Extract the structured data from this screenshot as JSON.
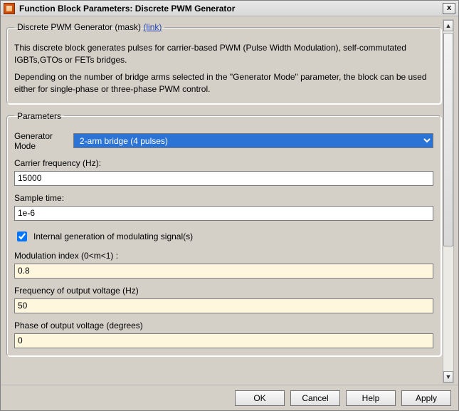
{
  "window": {
    "title": "Function Block Parameters: Discrete PWM Generator"
  },
  "description": {
    "legend_text": "Discrete PWM Generator (mask)",
    "legend_link": "(link)",
    "para1": "This discrete block generates pulses for carrier-based PWM (Pulse Width Modulation), self-commutated IGBTs,GTOs or FETs bridges.",
    "para2": "Depending on the number of bridge arms selected in the \"Generator Mode\" parameter, the block can be used either for single-phase or three-phase PWM control."
  },
  "parameters": {
    "legend": "Parameters",
    "generator_mode_label": "Generator Mode",
    "generator_mode_value": "2-arm  bridge (4 pulses)",
    "carrier_freq_label": "Carrier frequency (Hz):",
    "carrier_freq_value": "15000",
    "sample_time_label": "Sample time:",
    "sample_time_value": "1e-6",
    "internal_gen_checked": true,
    "internal_gen_label": "Internal generation of modulating signal(s)",
    "mod_index_label": "Modulation index  (0<m<1) :",
    "mod_index_value": "0.8",
    "out_freq_label": "Frequency of output voltage (Hz)",
    "out_freq_value": "50",
    "out_phase_label": "Phase of output voltage (degrees)",
    "out_phase_value": "0"
  },
  "buttons": {
    "ok": "OK",
    "cancel": "Cancel",
    "help": "Help",
    "apply": "Apply"
  }
}
